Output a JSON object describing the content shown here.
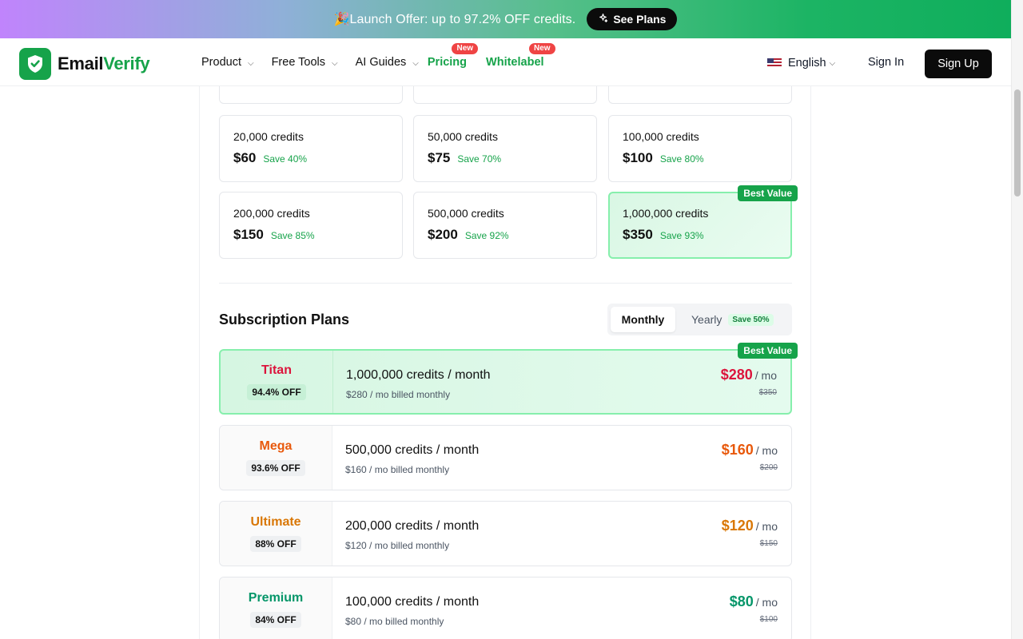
{
  "promo": {
    "emoji": "🎉",
    "text": "Launch Offer: up to 97.2% OFF credits.",
    "button_icon": "sparkle-icon",
    "button_label": "See Plans"
  },
  "nav": {
    "logo_part1": "Email",
    "logo_part2": "Verify",
    "menu": [
      {
        "label": "Product"
      },
      {
        "label": "Free Tools"
      },
      {
        "label": "AI Guides"
      }
    ],
    "pricing": "Pricing",
    "whitelabel": "Whitelabel",
    "new_badge": "New",
    "language": "English",
    "sign_in": "Sign In",
    "sign_up": "Sign Up"
  },
  "credit_packs": [
    {
      "credits": "20,000 credits",
      "price": "$60",
      "save": "Save 40%"
    },
    {
      "credits": "50,000 credits",
      "price": "$75",
      "save": "Save 70%"
    },
    {
      "credits": "100,000 credits",
      "price": "$100",
      "save": "Save 80%"
    },
    {
      "credits": "200,000 credits",
      "price": "$150",
      "save": "Save 85%"
    },
    {
      "credits": "500,000 credits",
      "price": "$200",
      "save": "Save 92%"
    },
    {
      "credits": "1,000,000 credits",
      "price": "$350",
      "save": "Save 93%",
      "badge": "Best Value"
    }
  ],
  "subscription": {
    "title": "Subscription Plans",
    "toggle_monthly": "Monthly",
    "toggle_yearly": "Yearly",
    "toggle_save": "Save 50%",
    "plans": [
      {
        "name": "Titan",
        "off": "94.4% OFF",
        "credits": "1,000,000 credits / month",
        "billed": "$280 / mo billed monthly",
        "price": "$280",
        "unit": "/ mo",
        "old": "$350",
        "color": "#dc143c",
        "badge": "Best Value"
      },
      {
        "name": "Mega",
        "off": "93.6% OFF",
        "credits": "500,000 credits / month",
        "billed": "$160 / mo billed monthly",
        "price": "$160",
        "unit": "/ mo",
        "old": "$200",
        "color": "#e8590c"
      },
      {
        "name": "Ultimate",
        "off": "88% OFF",
        "credits": "200,000 credits / month",
        "billed": "$120 / mo billed monthly",
        "price": "$120",
        "unit": "/ mo",
        "old": "$150",
        "color": "#d97706"
      },
      {
        "name": "Premium",
        "off": "84% OFF",
        "credits": "100,000 credits / month",
        "billed": "$80 / mo billed monthly",
        "price": "$80",
        "unit": "/ mo",
        "old": "$100",
        "color": "#059669"
      }
    ]
  }
}
